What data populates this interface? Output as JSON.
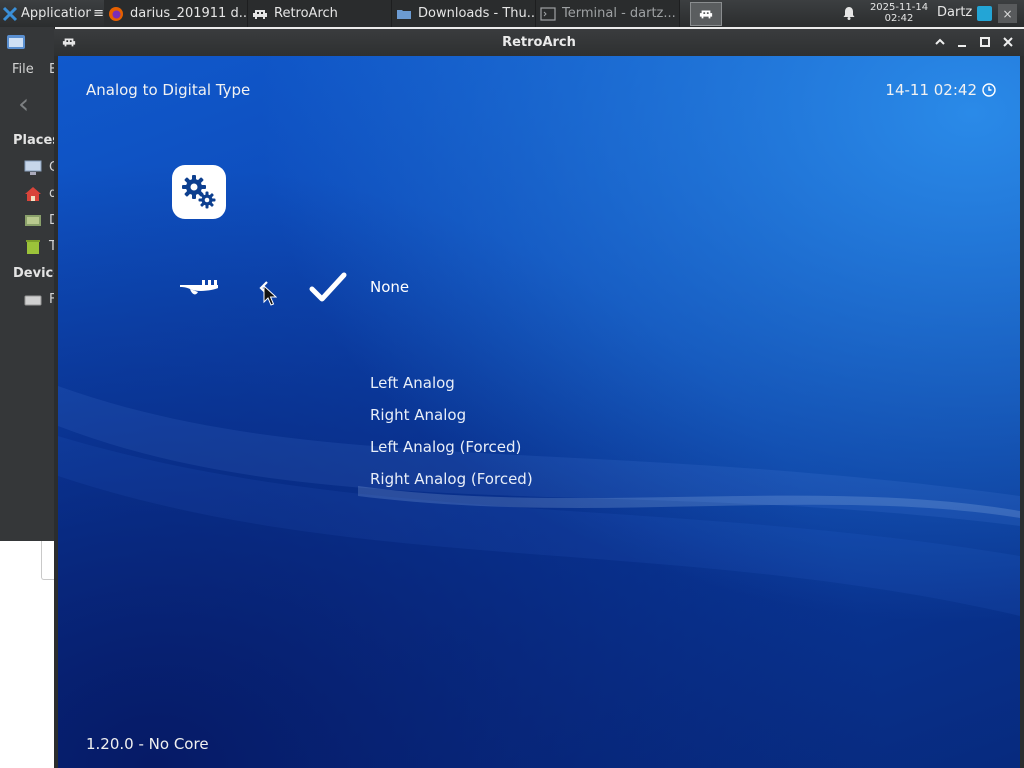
{
  "taskbar": {
    "apps_label": "Applications",
    "apps_suffix": "≡",
    "windows": [
      {
        "label": "darius_201911 d...",
        "icon": "firefox-icon"
      },
      {
        "label": "RetroArch",
        "icon": "retroarch-icon"
      },
      {
        "label": "Downloads - Thu...",
        "icon": "folder-icon"
      },
      {
        "label": "Terminal - dartz...",
        "icon": "terminal-icon"
      }
    ],
    "clock_date": "2025-11-14",
    "clock_time": "02:42",
    "user": "Dartz",
    "close_glyph": "×"
  },
  "file_manager": {
    "menu_file": "File",
    "menu_edit": "E",
    "back_glyph": "‹",
    "places_header": "Places",
    "devices_header": "Device",
    "places": [
      {
        "label": "C",
        "icon": "computer-icon"
      },
      {
        "label": "d",
        "icon": "home-icon"
      },
      {
        "label": "D",
        "icon": "desktop-icon"
      },
      {
        "label": "T",
        "icon": "trash-icon"
      }
    ],
    "devices": [
      {
        "label": "F",
        "icon": "drive-icon"
      }
    ]
  },
  "window": {
    "title": "RetroArch"
  },
  "retroarch": {
    "menu_title": "Analog to Digital Type",
    "clock": "14-11 02:42",
    "options": [
      {
        "label": "None",
        "selected": true
      },
      {
        "label": "Left Analog",
        "selected": false
      },
      {
        "label": "Right Analog",
        "selected": false
      },
      {
        "label": "Left Analog (Forced)",
        "selected": false
      },
      {
        "label": "Right Analog (Forced)",
        "selected": false
      }
    ],
    "footer": "1.20.0 - No Core"
  },
  "colors": {
    "background_top": "#1059cc",
    "background_bottom": "#072a7e",
    "taskbar": "#2b2d2e",
    "accent": "#23a5d6"
  }
}
